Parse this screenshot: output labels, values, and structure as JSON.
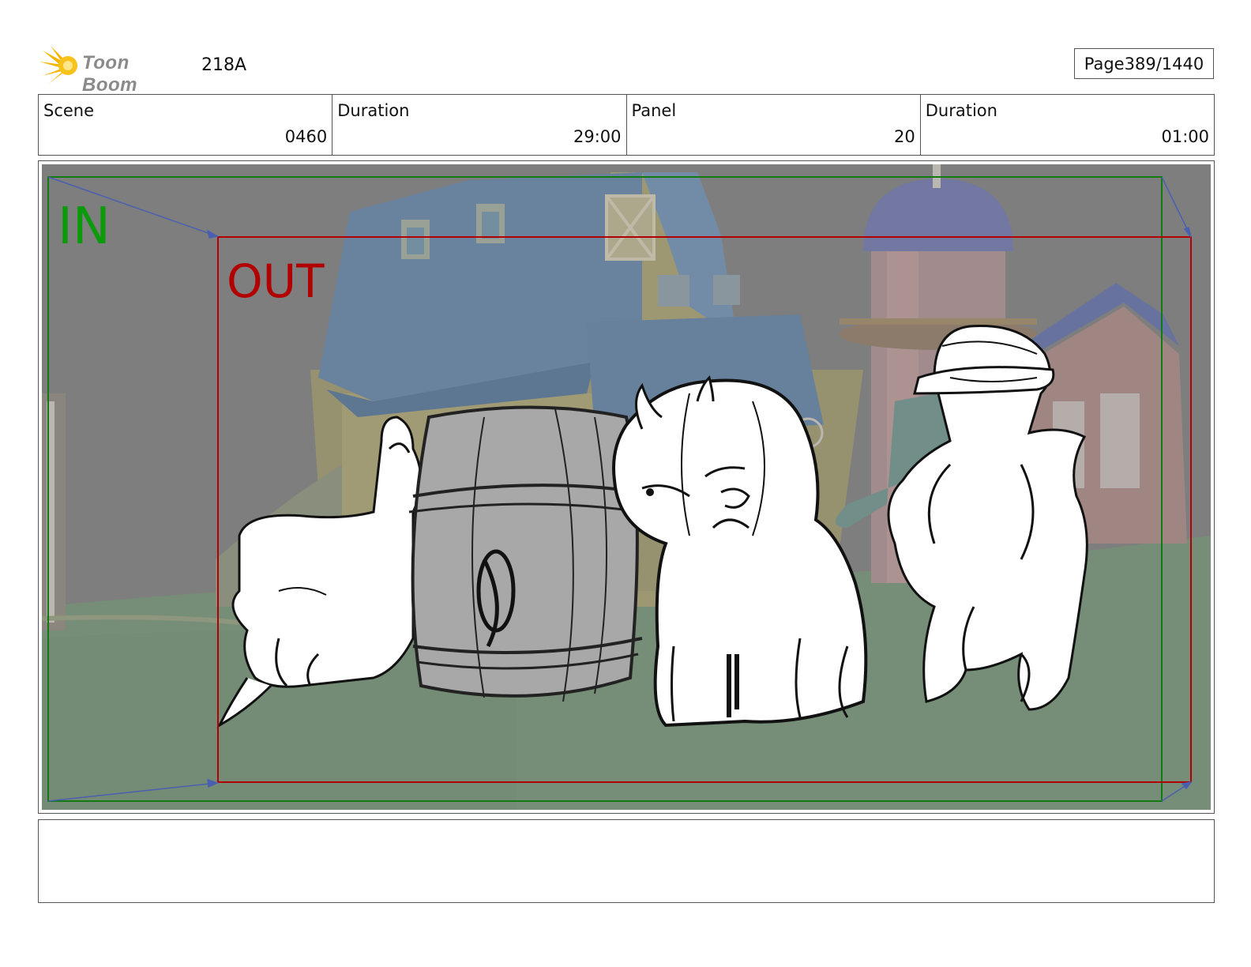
{
  "header": {
    "logo_text": "Toon Boom",
    "production_code": "218A",
    "page_label": "Page",
    "page_number": "389/1440"
  },
  "info": {
    "scene_label": "Scene",
    "scene_value": "0460",
    "scene_duration_label": "Duration",
    "scene_duration_value": "29:00",
    "panel_label": "Panel",
    "panel_value": "20",
    "panel_duration_label": "Duration",
    "panel_duration_value": "01:00"
  },
  "panel": {
    "in_label": "IN",
    "out_label": "OUT",
    "in_color": "#0a9a0a",
    "out_color": "#b20000"
  },
  "notes": {
    "text": ""
  }
}
